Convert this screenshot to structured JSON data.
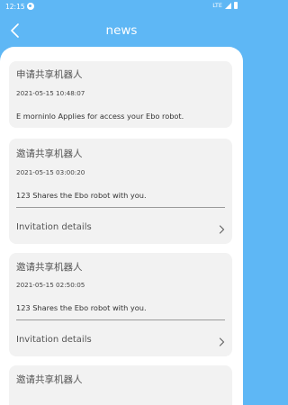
{
  "status": {
    "time": "12:15",
    "network": "LTE"
  },
  "header": {
    "title": "news"
  },
  "cards": [
    {
      "title": "申请共享机器人",
      "time": "2021-05-15 10:48:07",
      "body": "E morninlo Applies for access your Ebo robot."
    },
    {
      "title": "邀请共享机器人",
      "time": "2021-05-15 03:00:20",
      "body": "123 Shares the Ebo robot with you.",
      "details": "Invitation details"
    },
    {
      "title": "邀请共享机器人",
      "time": "2021-05-15 02:50:05",
      "body": "123 Shares the Ebo robot with you.",
      "details": "Invitation details"
    },
    {
      "title": "邀请共享机器人"
    }
  ],
  "colors": {
    "header_bg": "#5eb7f5",
    "card_bg": "#f2f2f2"
  },
  "icons": {
    "back": "back-chevron-icon",
    "details": "chevron-right-icon"
  }
}
